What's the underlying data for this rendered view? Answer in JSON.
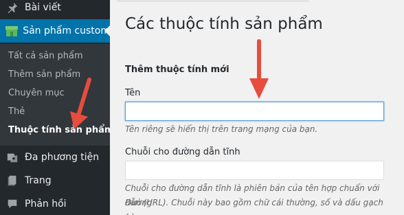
{
  "sidebar": {
    "items": [
      {
        "label": "Bài viết",
        "icon": "pin-icon"
      },
      {
        "label": "Sản phẩm custom",
        "icon": "store-icon",
        "current": true
      },
      {
        "label": "Đa phương tiện",
        "icon": "media-icon"
      },
      {
        "label": "Trang",
        "icon": "page-icon"
      },
      {
        "label": "Phản hồi",
        "icon": "comment-icon"
      }
    ],
    "submenu": [
      {
        "label": "Tất cả sản phẩm"
      },
      {
        "label": "Thêm sản phẩm"
      },
      {
        "label": "Chuyên mục"
      },
      {
        "label": "Thẻ"
      },
      {
        "label": "Thuộc tính sản phẩm",
        "current": true
      }
    ]
  },
  "main": {
    "page_title": "Các thuộc tính sản phẩm",
    "section_title": "Thêm thuộc tính mới",
    "name_field": {
      "label": "Tên",
      "value": "",
      "description": "Tên riêng sẽ hiển thị trên trang mạng của bạn."
    },
    "slug_field": {
      "label": "Chuỗi cho đường dẫn tĩnh",
      "value": "",
      "description_line1": "Chuỗi cho đường dẫn tĩnh là phiên bản của tên hợp chuẩn với Đường",
      "description_line2": "dẫn (URL). Chuỗi này bao gồm chữ cái thường, số và dấu gạch ngang",
      "description_line3": "(-)."
    }
  },
  "colors": {
    "sidebar_bg": "#23282d",
    "submenu_bg": "#32373c",
    "accent": "#0073aa",
    "arrow": "#e74c3c"
  }
}
